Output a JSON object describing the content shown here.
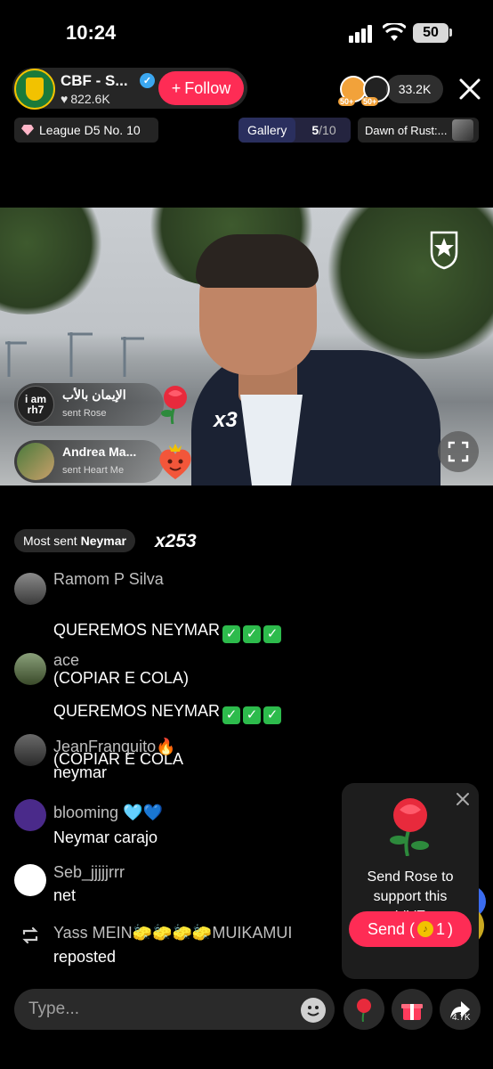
{
  "status_bar": {
    "time": "10:24",
    "battery": "50"
  },
  "host": {
    "name": "CBF - S...",
    "likes": "822.6K",
    "follow_label": "Follow",
    "viewer_levels": [
      "50+",
      "50+"
    ],
    "viewer_count": "33.2K"
  },
  "tags": {
    "league": "League D5 No. 10",
    "gallery_label": "Gallery",
    "gallery_current": "5",
    "gallery_total": "/10",
    "dawn": "Dawn of Rust:..."
  },
  "video": {
    "gifts": [
      {
        "user": "الإيمان بالأب",
        "badge": "i am rh7",
        "sent": "sent Rose",
        "gift": "rose"
      },
      {
        "user": "Andrea Ma...",
        "sent": "sent Heart Me",
        "gift": "heart"
      }
    ],
    "combo": "x3"
  },
  "most_sent": {
    "label_prefix": "Most sent",
    "name": "Neymar",
    "count": "x253"
  },
  "chat": [
    {
      "user": "Ramom P Silva",
      "message": "QUEREMOS NEYMAR",
      "checks": 3,
      "message2": "(COPIAR E COLA)"
    },
    {
      "user": "ace",
      "message": "QUEREMOS NEYMAR",
      "checks": 3,
      "message2": "(COPIAR E COLA"
    },
    {
      "user": "JeanFranquito🔥",
      "message": "neymar"
    },
    {
      "user": "blooming 🩵💙",
      "message": "Neymar carajo"
    },
    {
      "user": "Seb_jjjjjrrr",
      "message": "net"
    },
    {
      "user": "Yass MEIN🧽🧽🧽🧽MUIKAMUI",
      "message": "reposted"
    }
  ],
  "rose_popup": {
    "text": "Send Rose to\nsupport this\nLIVE",
    "send_label": "Send (",
    "send_cost": "1",
    "send_suffix": ")"
  },
  "bottom": {
    "input_placeholder": "Type...",
    "share_count": "4.7K"
  },
  "colors": {
    "accent": "#fe2c55",
    "verified": "#3ba7f0",
    "check": "#2dbb4c"
  }
}
